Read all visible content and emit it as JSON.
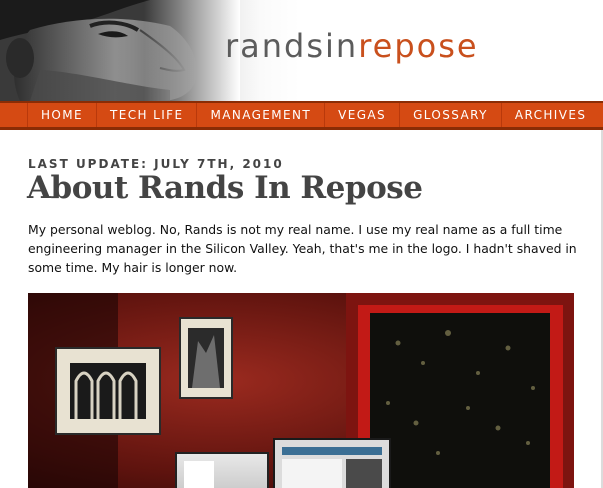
{
  "header": {
    "logo_part1": "randsin",
    "logo_part2": "repose"
  },
  "nav": {
    "items": [
      "HOME",
      "TECH LIFE",
      "MANAGEMENT",
      "VEGAS",
      "GLOSSARY",
      "ARCHIVES"
    ]
  },
  "article": {
    "kicker": "LAST UPDATE: JULY 7TH, 2010",
    "title": "About Rands In Repose",
    "body": "My personal weblog. No, Rands is not my real name. I use my real name as a full time engineering manager in the Silicon Valley. Yeah, that's me in the logo. I hadn't shaved in some time. My hair is longer now."
  },
  "colors": {
    "nav_bg": "#d54a13",
    "logo_accent": "#c9501d",
    "logo_gray": "#5c5c5c",
    "text": "#444444"
  }
}
